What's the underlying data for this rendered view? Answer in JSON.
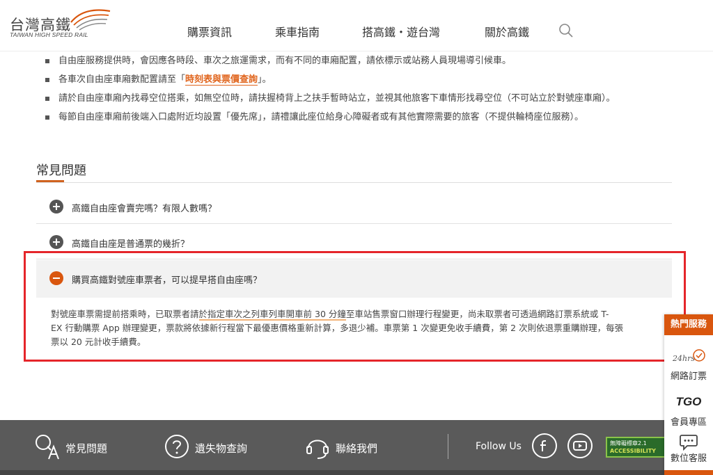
{
  "brand": {
    "name_zh": "台灣高鐵",
    "name_en": "TAIWAN HIGH SPEED RAIL"
  },
  "nav": {
    "items": [
      "購票資訊",
      "乘車指南",
      "搭高鐵・遊台灣",
      "關於高鐵"
    ]
  },
  "bullets": [
    {
      "text": "自由座服務提供時，會因應各時段、車次之旅運需求，而有不同的車廂配置，請依標示或站務人員現場導引候車。"
    },
    {
      "pre": "各車次自由座車廂數配置請至「",
      "link": "時刻表與票價查詢",
      "post": "」。"
    },
    {
      "text": "請於自由座車廂內找尋空位搭乘，如無空位時，請扶握椅背上之扶手暫時站立，並視其他旅客下車情形找尋空位（不可站立於對號座車廂）。"
    },
    {
      "text": "每節自由座車廂前後端入口處附近均設置「優先席」，請禮讓此座位給身心障礙者或有其他實際需要的旅客（不提供輪椅座位服務）。"
    }
  ],
  "faq": {
    "title": "常見問題",
    "items": [
      {
        "question": "高鐵自由座會賣完嗎？有限人數嗎？"
      },
      {
        "question": "高鐵自由座是普通票的幾折？"
      },
      {
        "question": "購買高鐵對號座車票者，可以提早搭自由座嗎？"
      }
    ],
    "answer": {
      "p1": "對號座車票需提前搭乘時，已取票者請",
      "p1_highlight": "於指定車次之列車列車開車前 30 分鐘",
      "p1_rest": "至車站售票窗口辦理行程變更，尚未取票者可透過網路訂票系統或 T-",
      "line2": "EX 行動購票 App 辦理變更，票款將依據新行程當下最優惠價格重新計算，多退少補。車票第 1 次變更免收手續費，第 2 次則依退票重購辦理，每張",
      "line3": "票以 20 元計收手續費。"
    }
  },
  "footer": {
    "links": [
      "常見問題",
      "遺失物查詢",
      "聯絡我們"
    ],
    "follow_label": "Follow Us",
    "social": [
      "facebook-icon",
      "youtube-icon"
    ],
    "badge_line1": "無障礙標章2.1",
    "badge_line2": "ACCESSIBILITY"
  },
  "side_panel": {
    "title": "熱門服務",
    "items": [
      {
        "label": "網路訂票",
        "icon_text": "24hrs"
      },
      {
        "label": "會員專區",
        "icon_text": "TGO"
      },
      {
        "label": "數位客服",
        "icon_text": ""
      }
    ]
  },
  "colors": {
    "accent": "#d9560e",
    "highlight_border": "#e5252a",
    "footer_bg": "#5a5a5a"
  }
}
